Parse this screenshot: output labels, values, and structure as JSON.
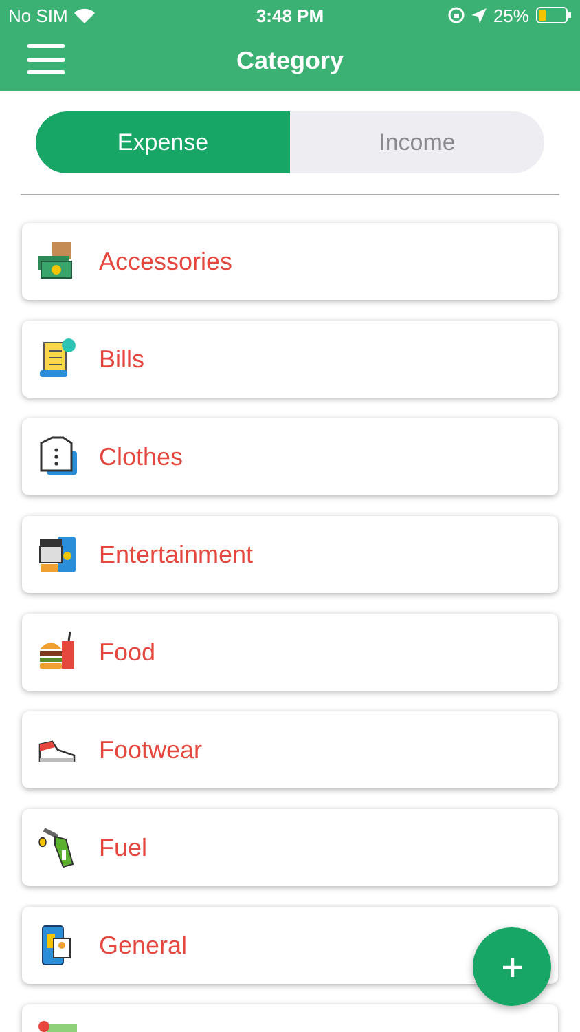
{
  "status_bar": {
    "carrier": "No SIM",
    "time": "3:48 PM",
    "battery": "25%"
  },
  "header": {
    "title": "Category"
  },
  "tabs": [
    {
      "label": "Expense",
      "selected": true
    },
    {
      "label": "Income",
      "selected": false
    }
  ],
  "categories": [
    {
      "label": "Accessories"
    },
    {
      "label": "Bills"
    },
    {
      "label": "Clothes"
    },
    {
      "label": "Entertainment"
    },
    {
      "label": "Food"
    },
    {
      "label": "Footwear"
    },
    {
      "label": "Fuel"
    },
    {
      "label": "General"
    }
  ]
}
